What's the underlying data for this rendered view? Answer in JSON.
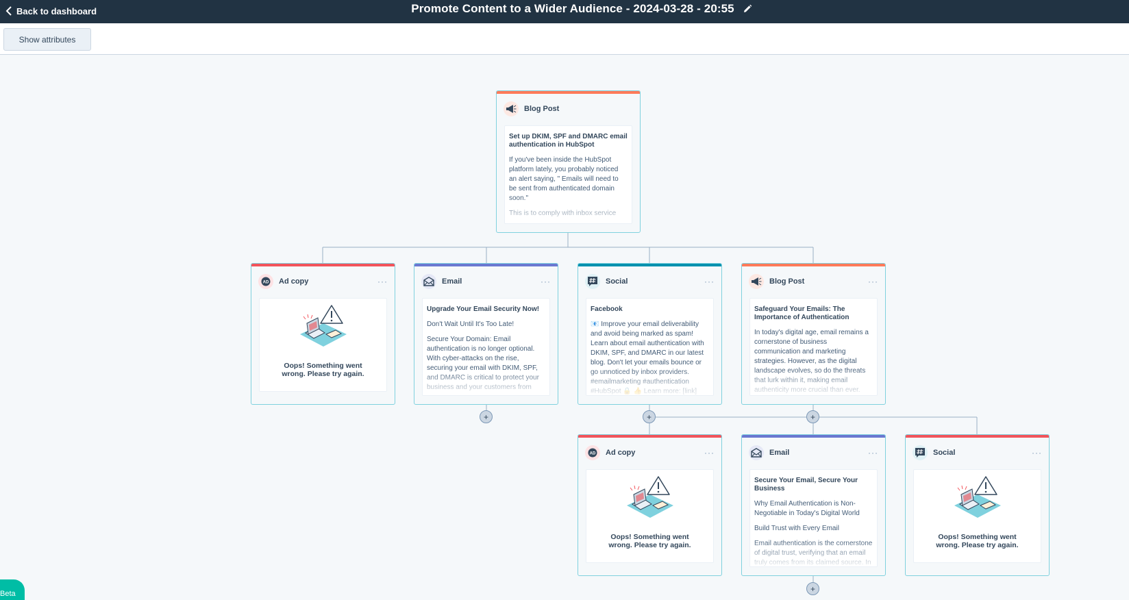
{
  "header": {
    "back_label": "Back to dashboard",
    "title": "Promote Content to a Wider Audience - 2024-03-28 - 20:55"
  },
  "toolbar": {
    "show_attributes_label": "Show attributes"
  },
  "colors": {
    "topbar": "#213343",
    "blog": "#ff7a59",
    "ad": "#f2545b",
    "email": "#6a78d1",
    "social": "#0091ae"
  },
  "cards": {
    "root": {
      "type": "Blog Post",
      "icon": "megaphone-icon",
      "title": "Set up DKIM, SPF and DMARC email authentication in HubSpot",
      "paragraphs": [
        "If you've been inside the HubSpot platform lately, you probably noticed an alert saying, \" Emails will need to be sent from authenticated domain soon.\"",
        "This is to comply with inbox service"
      ]
    },
    "ad_copy_1": {
      "type": "Ad copy",
      "icon": "ad-icon",
      "more": "···",
      "error": "Oops! Something went wrong. Please try again."
    },
    "email_1": {
      "type": "Email",
      "icon": "envelope-icon",
      "more": "···",
      "title": "Upgrade Your Email Security Now!",
      "paragraphs": [
        "Don't Wait Until It's Too Late!",
        "Secure Your Domain: Email authentication is no longer optional. With cyber-attacks on the rise, securing your email with DKIM, SPF, and DMARC is critical to protect your business and your customers from"
      ]
    },
    "social_1": {
      "type": "Social",
      "icon": "hashtag-chat-icon",
      "more": "···",
      "title": "Facebook",
      "paragraphs": [
        "📧 Improve your email deliverability and avoid being marked as spam! Learn about email authentication with DKIM, SPF, and DMARC in our latest blog. Don't let your emails bounce or go unnoticed by inbox providers. #emailmarketing #authentication #HubSpot 🔒 👍 Learn more: [link]"
      ]
    },
    "blog_2": {
      "type": "Blog Post",
      "icon": "megaphone-icon",
      "more": "···",
      "title": "Safeguard Your Emails: The Importance of Authentication",
      "paragraphs": [
        "In today's digital age, email remains a cornerstone of business communication and marketing strategies. However, as the digital landscape evolves, so do the threats that lurk within it, making email authenticity more crucial than ever."
      ]
    },
    "ad_copy_2": {
      "type": "Ad copy",
      "icon": "ad-icon",
      "more": "···",
      "error": "Oops! Something went wrong. Please try again."
    },
    "email_2": {
      "type": "Email",
      "icon": "envelope-icon",
      "more": "···",
      "title": "Secure Your Email, Secure Your Business",
      "paragraphs": [
        "Why Email Authentication is Non-Negotiable in Today's Digital World",
        "Build Trust with Every Email",
        "Email authentication is the cornerstone of digital trust, verifying that an email truly comes from its claimed source. In"
      ]
    },
    "social_2": {
      "type": "Social",
      "icon": "hashtag-chat-icon",
      "more": "···",
      "error": "Oops! Something went wrong. Please try again."
    }
  },
  "add_button": "+",
  "beta_label": "Beta"
}
